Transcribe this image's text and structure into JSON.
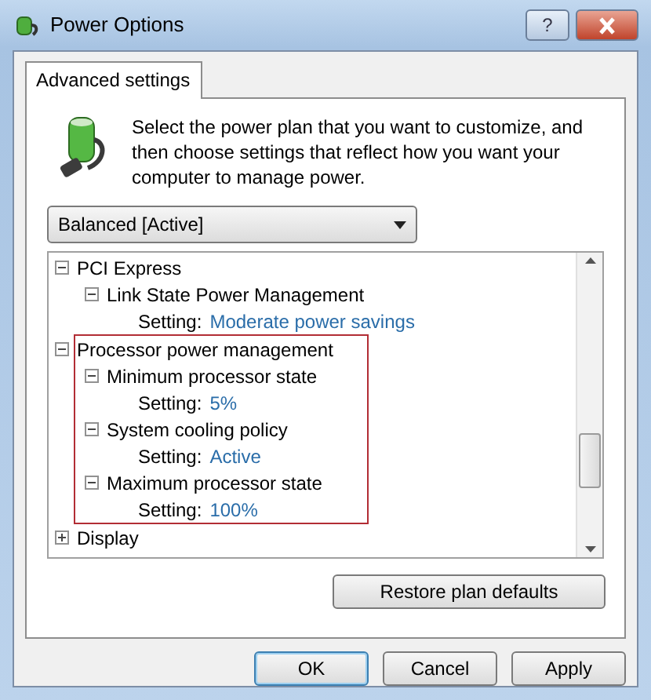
{
  "window": {
    "title": "Power Options",
    "help_button": "?"
  },
  "tabs": [
    {
      "label": "Advanced settings",
      "selected": true
    }
  ],
  "intro": "Select the power plan that you want to customize, and then choose settings that reflect how you want your computer to manage power.",
  "plan_select": {
    "value": "Balanced [Active]"
  },
  "tree": [
    {
      "kind": "group",
      "label": "PCI Express",
      "expanded": true,
      "children": [
        {
          "kind": "group",
          "label": "Link State Power Management",
          "expanded": true,
          "children": [
            {
              "kind": "setting",
              "label": "Setting:",
              "value": "Moderate power savings"
            }
          ]
        }
      ]
    },
    {
      "kind": "group",
      "label": "Processor power management",
      "expanded": true,
      "highlighted": true,
      "children": [
        {
          "kind": "group",
          "label": "Minimum processor state",
          "expanded": true,
          "children": [
            {
              "kind": "setting",
              "label": "Setting:",
              "value": "5%"
            }
          ]
        },
        {
          "kind": "group",
          "label": "System cooling policy",
          "expanded": true,
          "children": [
            {
              "kind": "setting",
              "label": "Setting:",
              "value": "Active"
            }
          ]
        },
        {
          "kind": "group",
          "label": "Maximum processor state",
          "expanded": true,
          "children": [
            {
              "kind": "setting",
              "label": "Setting:",
              "value": "100%"
            }
          ]
        }
      ]
    },
    {
      "kind": "group",
      "label": "Display",
      "expanded": false
    }
  ],
  "restore_button": "Restore plan defaults",
  "buttons": [
    {
      "label": "OK",
      "default": true
    },
    {
      "label": "Cancel",
      "default": false
    },
    {
      "label": "Apply",
      "default": false
    }
  ]
}
